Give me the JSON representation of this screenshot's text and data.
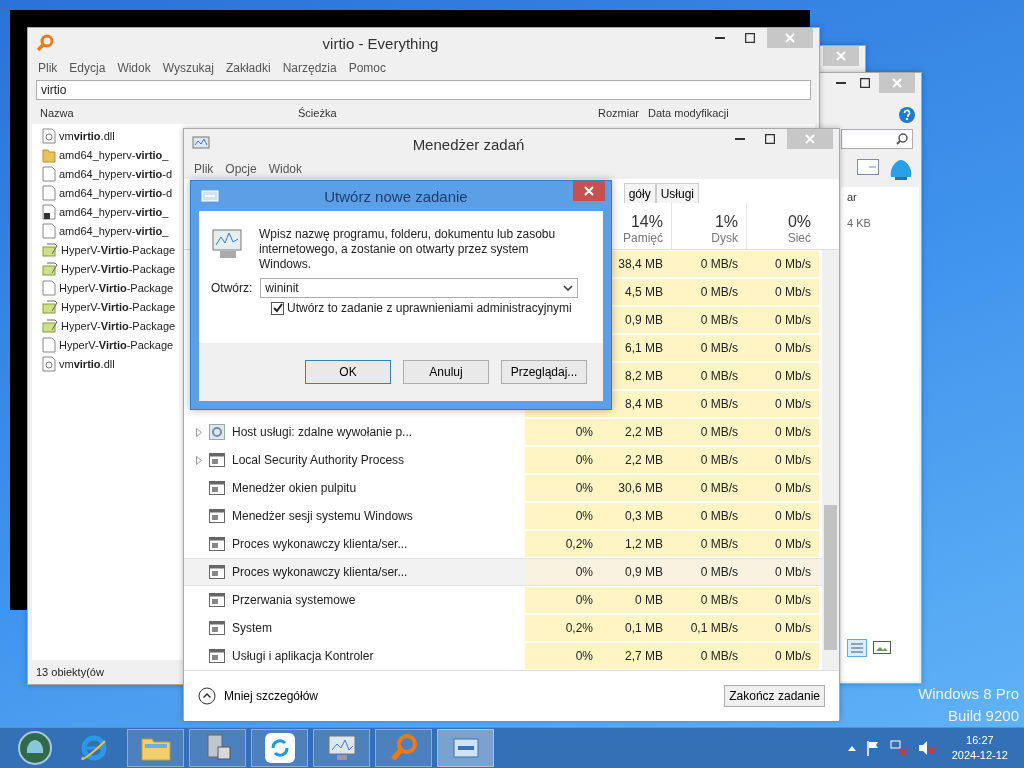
{
  "back_window": {
    "header_fragment": "ar",
    "size": "4 KB"
  },
  "everything": {
    "title": "virtio - Everything",
    "menu": [
      "Plik",
      "Edycja",
      "Widok",
      "Wyszukaj",
      "Zakładki",
      "Narzędzia",
      "Pomoc"
    ],
    "search": {
      "value": "virtio"
    },
    "columns": [
      "Nazwa",
      "Ścieżka",
      "Rozmiar",
      "Data modyfikacji"
    ],
    "rows": [
      {
        "name": "vm**virtio**.dll",
        "kind": "dll"
      },
      {
        "name": "amd64_hyperv-**virtio**_",
        "kind": "folder"
      },
      {
        "name": "amd64_hyperv-**virtio**-d",
        "kind": "file"
      },
      {
        "name": "amd64_hyperv-**virtio**-d",
        "kind": "file"
      },
      {
        "name": "amd64_hyperv-**virtio**_",
        "kind": "shortcut"
      },
      {
        "name": "amd64_hyperv-**virtio**_",
        "kind": "file"
      },
      {
        "name": "HyperV-**Virtio**-Package",
        "kind": "package"
      },
      {
        "name": "HyperV-**Virtio**-Package",
        "kind": "package"
      },
      {
        "name": "HyperV-**Virtio**-Package",
        "kind": "file"
      },
      {
        "name": "HyperV-**Virtio**-Package",
        "kind": "package"
      },
      {
        "name": "HyperV-**Virtio**-Package",
        "kind": "package"
      },
      {
        "name": "HyperV-**Virtio**-Package",
        "kind": "file"
      },
      {
        "name": "vm**virtio**.dll",
        "kind": "dll"
      }
    ],
    "status": "13 obiekty(ów"
  },
  "task_manager": {
    "title": "Menedżer zadań",
    "menu": [
      "Plik",
      "Opcje",
      "Widok"
    ],
    "tabs": [
      {
        "label": "góły",
        "selected": false
      },
      {
        "label": "Usługi",
        "selected": false
      }
    ],
    "columns": [
      {
        "percent": "14%",
        "label": "Pamięć"
      },
      {
        "percent": "1%",
        "label": "Dysk"
      },
      {
        "percent": "0%",
        "label": "Sieć"
      }
    ],
    "rows": [
      {
        "memory": "38,4 MB",
        "disk": "0 MB/s",
        "network": "0 Mb/s",
        "selected": false
      },
      {
        "memory": "4,5 MB",
        "disk": "0 MB/s",
        "network": "0 Mb/s",
        "selected": false
      },
      {
        "memory": "0,9 MB",
        "disk": "0 MB/s",
        "network": "0 Mb/s",
        "selected": false
      },
      {
        "memory": "6,1 MB",
        "disk": "0 MB/s",
        "network": "0 Mb/s",
        "selected": false
      },
      {
        "memory": "8,2 MB",
        "disk": "0 MB/s",
        "network": "0 Mb/s",
        "selected": false
      },
      {
        "memory": "8,4 MB",
        "disk": "0 MB/s",
        "network": "0 Mb/s",
        "selected": false
      },
      {
        "kind": "service",
        "expandable": true,
        "name": "Host usługi: zdalne wywołanie p...",
        "cpu": "0%",
        "memory": "2,2 MB",
        "disk": "0 MB/s",
        "network": "0 Mb/s",
        "selected": false
      },
      {
        "kind": "process",
        "expandable": true,
        "name": "Local Security Authority Process",
        "cpu": "0%",
        "memory": "2,2 MB",
        "disk": "0 MB/s",
        "network": "0 Mb/s",
        "selected": false
      },
      {
        "kind": "process",
        "expandable": false,
        "name": "Menedżer okien pulpitu",
        "cpu": "0%",
        "memory": "30,6 MB",
        "disk": "0 MB/s",
        "network": "0 Mb/s",
        "selected": false
      },
      {
        "kind": "process",
        "expandable": false,
        "name": "Menedżer sesji systemu Windows",
        "cpu": "0%",
        "memory": "0,3 MB",
        "disk": "0 MB/s",
        "network": "0 Mb/s",
        "selected": false
      },
      {
        "kind": "process",
        "expandable": false,
        "name": "Proces wykonawczy klienta/ser...",
        "cpu": "0,2%",
        "memory": "1,2 MB",
        "disk": "0 MB/s",
        "network": "0 Mb/s",
        "selected": false
      },
      {
        "kind": "process",
        "expandable": false,
        "name": "Proces wykonawczy klienta/ser...",
        "cpu": "0%",
        "memory": "0,9 MB",
        "disk": "0 MB/s",
        "network": "0 Mb/s",
        "selected": true
      },
      {
        "kind": "process",
        "expandable": false,
        "name": "Przerwania systemowe",
        "cpu": "0%",
        "memory": "0 MB",
        "disk": "0 MB/s",
        "network": "0 Mb/s",
        "selected": false
      },
      {
        "kind": "process",
        "expandable": false,
        "name": "System",
        "cpu": "0,2%",
        "memory": "0,1 MB",
        "disk": "0,1 MB/s",
        "network": "0 Mb/s",
        "selected": false
      },
      {
        "kind": "process",
        "expandable": false,
        "name": "Usługi i aplikacja Kontroler",
        "cpu": "0%",
        "memory": "2,7 MB",
        "disk": "0 MB/s",
        "network": "0 Mb/s",
        "selected": false
      }
    ],
    "less_details": "Mniej szczegółów",
    "end_task": "Zakończ zadanie"
  },
  "dialog": {
    "title": "Utwórz nowe zadanie",
    "description": "Wpisz nazwę programu, folderu, dokumentu lub zasobu internetowego, a zostanie on otwarty przez system Windows.",
    "open_label": "Otwórz:",
    "open_value": "wininit",
    "admin": {
      "label": "Utwórz to zadanie z uprawnieniami administracyjnymi",
      "checked": true
    },
    "buttons": [
      "OK",
      "Anuluj",
      "Przeglądaj..."
    ]
  },
  "os_info": [
    "Windows 8 Pro",
    "Build 9200"
  ],
  "taskbar": {
    "apps": [
      {
        "kind": "ie",
        "running": false,
        "selected": false
      },
      {
        "kind": "explorer",
        "running": true,
        "selected": false
      },
      {
        "kind": "installer",
        "running": true,
        "selected": false
      },
      {
        "kind": "sync",
        "running": true,
        "selected": false
      },
      {
        "kind": "taskmgr",
        "running": true,
        "selected": false
      },
      {
        "kind": "everything",
        "running": true,
        "selected": false
      },
      {
        "kind": "dialog",
        "running": true,
        "selected": true
      }
    ],
    "time": "16:27",
    "date": "2024-12-12"
  }
}
